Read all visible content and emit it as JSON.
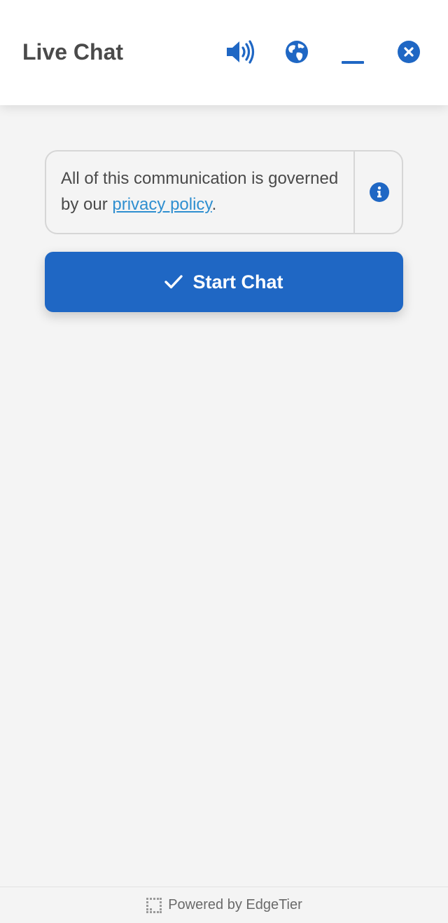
{
  "header": {
    "title": "Live Chat",
    "icons": [
      "volume-icon",
      "globe-icon",
      "minimize-icon",
      "close-icon"
    ]
  },
  "notice": {
    "text_before": "All of this communication is governed by our ",
    "link_text": "privacy policy",
    "text_after": ".",
    "icon": "info-icon"
  },
  "start_button": {
    "label": "Start Chat",
    "icon": "check-icon"
  },
  "footer": {
    "text": "Powered by EdgeTier",
    "icon": "edgetier-logo-icon"
  },
  "colors": {
    "accent": "#1f67c4",
    "link": "#2f8fd0",
    "background": "#f4f4f4",
    "header_background": "#ffffff",
    "text": "#4a4a4a"
  }
}
